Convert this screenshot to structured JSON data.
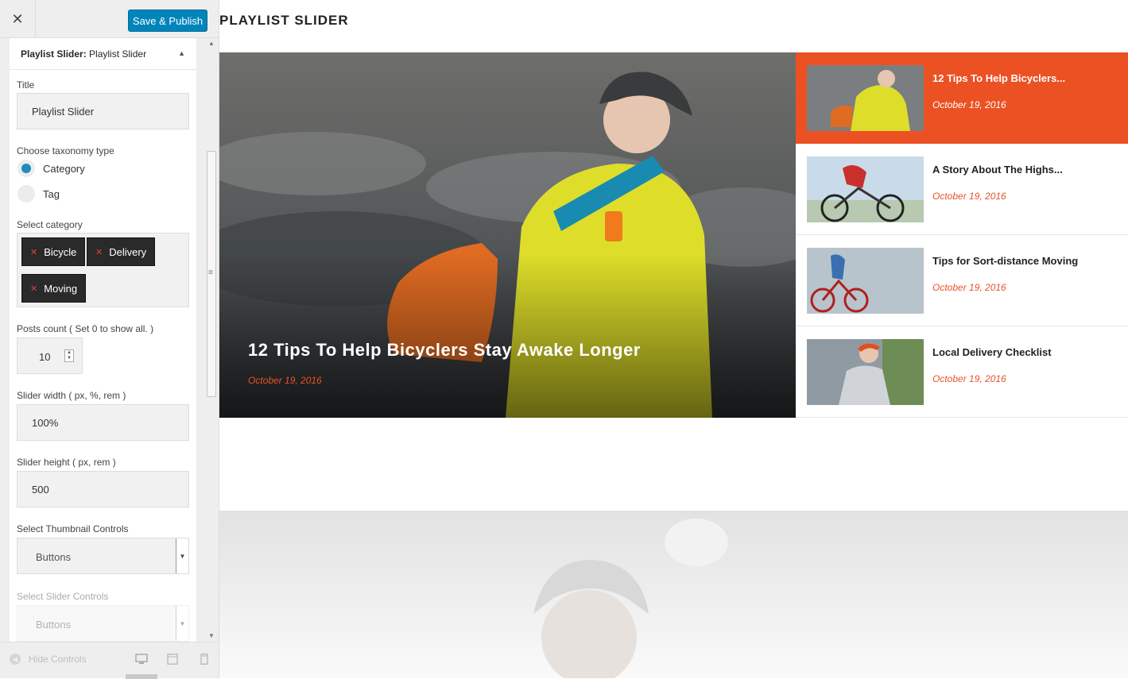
{
  "panel": {
    "close_label": "✕",
    "publish_label": "Save & Publish",
    "widget_prefix": "Playlist Slider:",
    "widget_name": "Playlist Slider",
    "fields": {
      "title_label": "Title",
      "title_value": "Playlist Slider",
      "taxonomy_label": "Choose taxonomy type",
      "taxonomy_options": [
        "Category",
        "Tag"
      ],
      "taxonomy_selected": "Category",
      "category_label": "Select category",
      "categories": [
        "Bicycle",
        "Delivery",
        "Moving"
      ],
      "posts_count_label": "Posts count ( Set 0 to show all. )",
      "posts_count_value": "10",
      "slider_width_label": "Slider width ( px, %, rem )",
      "slider_width_value": "100%",
      "slider_height_label": "Slider height ( px, rem )",
      "slider_height_value": "500",
      "thumb_controls_label": "Select Thumbnail Controls",
      "thumb_controls_value": "Buttons",
      "slider_controls_label": "Select Slider Controls",
      "slider_controls_value": "Buttons"
    },
    "footer": {
      "hide_controls_label": "Hide Controls"
    }
  },
  "preview": {
    "section_title": "PLAYLIST SLIDER",
    "hero": {
      "title": "12 Tips To Help Bicyclers Stay Awake Longer",
      "date": "October 19, 2016"
    },
    "playlist": [
      {
        "title": "12 Tips To Help Bicyclers...",
        "date": "October 19, 2016",
        "active": true
      },
      {
        "title": "A Story About The Highs...",
        "date": "October 19, 2016",
        "active": false
      },
      {
        "title": "Tips for Sort-distance Moving",
        "date": "October 19, 2016",
        "active": false
      },
      {
        "title": "Local Delivery Checklist",
        "date": "October 19, 2016",
        "active": false
      }
    ]
  },
  "colors": {
    "accent": "#ec5124",
    "publish": "#0085ba",
    "radio_selected": "#1e8cbe"
  }
}
